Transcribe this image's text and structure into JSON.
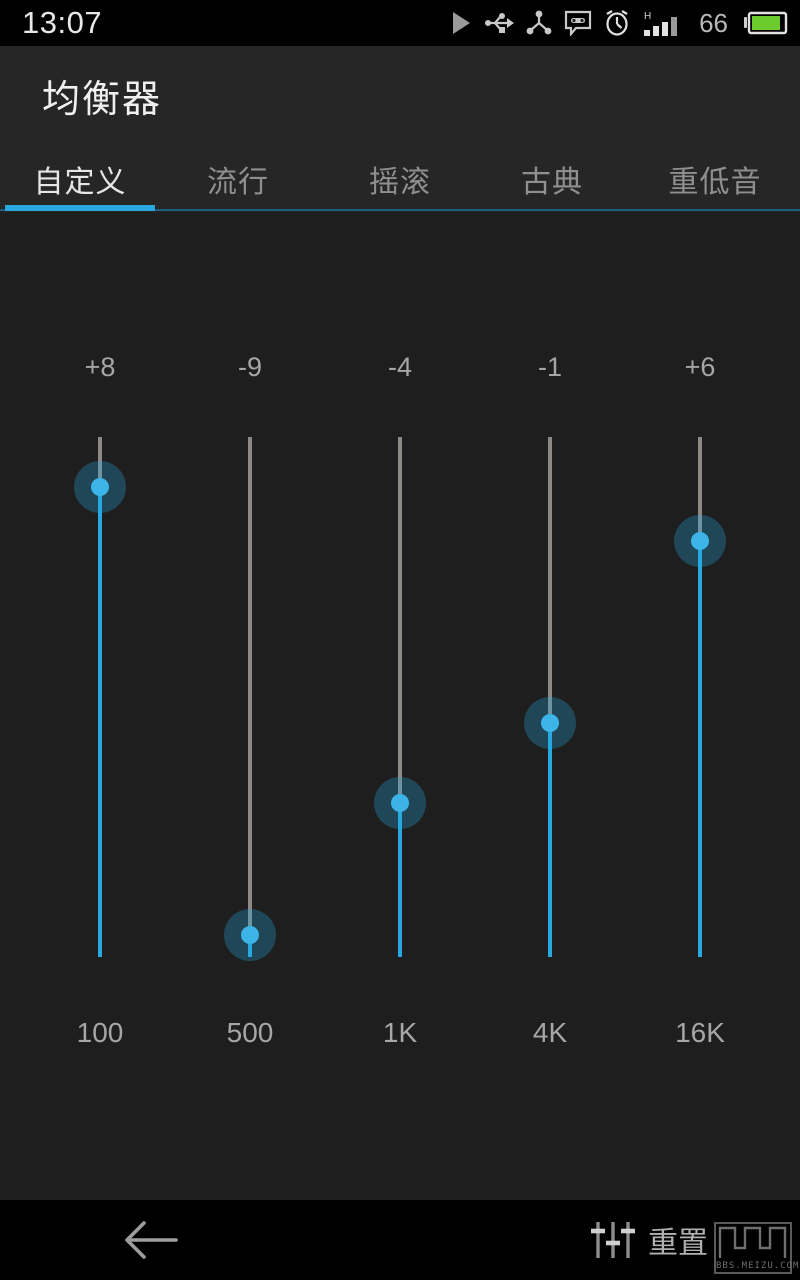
{
  "status_bar": {
    "time": "13:07",
    "battery_percent": "66",
    "network_type": "H",
    "icons": [
      "play-icon",
      "usb-icon",
      "share-icon",
      "voicemail-icon",
      "alarm-icon",
      "signal-bars-icon",
      "battery-icon"
    ]
  },
  "header": {
    "title": "均衡器"
  },
  "tabs": [
    {
      "label": "自定义",
      "active": true
    },
    {
      "label": "流行",
      "active": false
    },
    {
      "label": "摇滚",
      "active": false
    },
    {
      "label": "古典",
      "active": false
    },
    {
      "label": "重低音",
      "active": false
    }
  ],
  "equalizer": {
    "bands": [
      {
        "frequency": "100",
        "value": "+8",
        "gain": 8,
        "percent": 90
      },
      {
        "frequency": "500",
        "value": "-9",
        "gain": -9,
        "percent": 4
      },
      {
        "frequency": "1K",
        "value": "-4",
        "gain": -4,
        "percent": 30
      },
      {
        "frequency": "4K",
        "value": "-1",
        "gain": -1,
        "percent": 45
      },
      {
        "frequency": "16K",
        "value": "+6",
        "gain": 6,
        "percent": 80
      }
    ],
    "range_min": -12,
    "range_max": 12
  },
  "nav_bar": {
    "back_label": "back-arrow",
    "reset_label": "重置",
    "reset_icon": "equalizer-icon"
  },
  "watermark": {
    "text": "BBS.MEIZU.COM"
  },
  "colors": {
    "accent": "#29a8e0",
    "accent_light": "#3cb4e8",
    "background": "#1e1e1e",
    "header_bg": "#262626",
    "track": "#8d8a86",
    "text_muted": "#a6a6a6",
    "battery_green": "#6ccc2e"
  }
}
